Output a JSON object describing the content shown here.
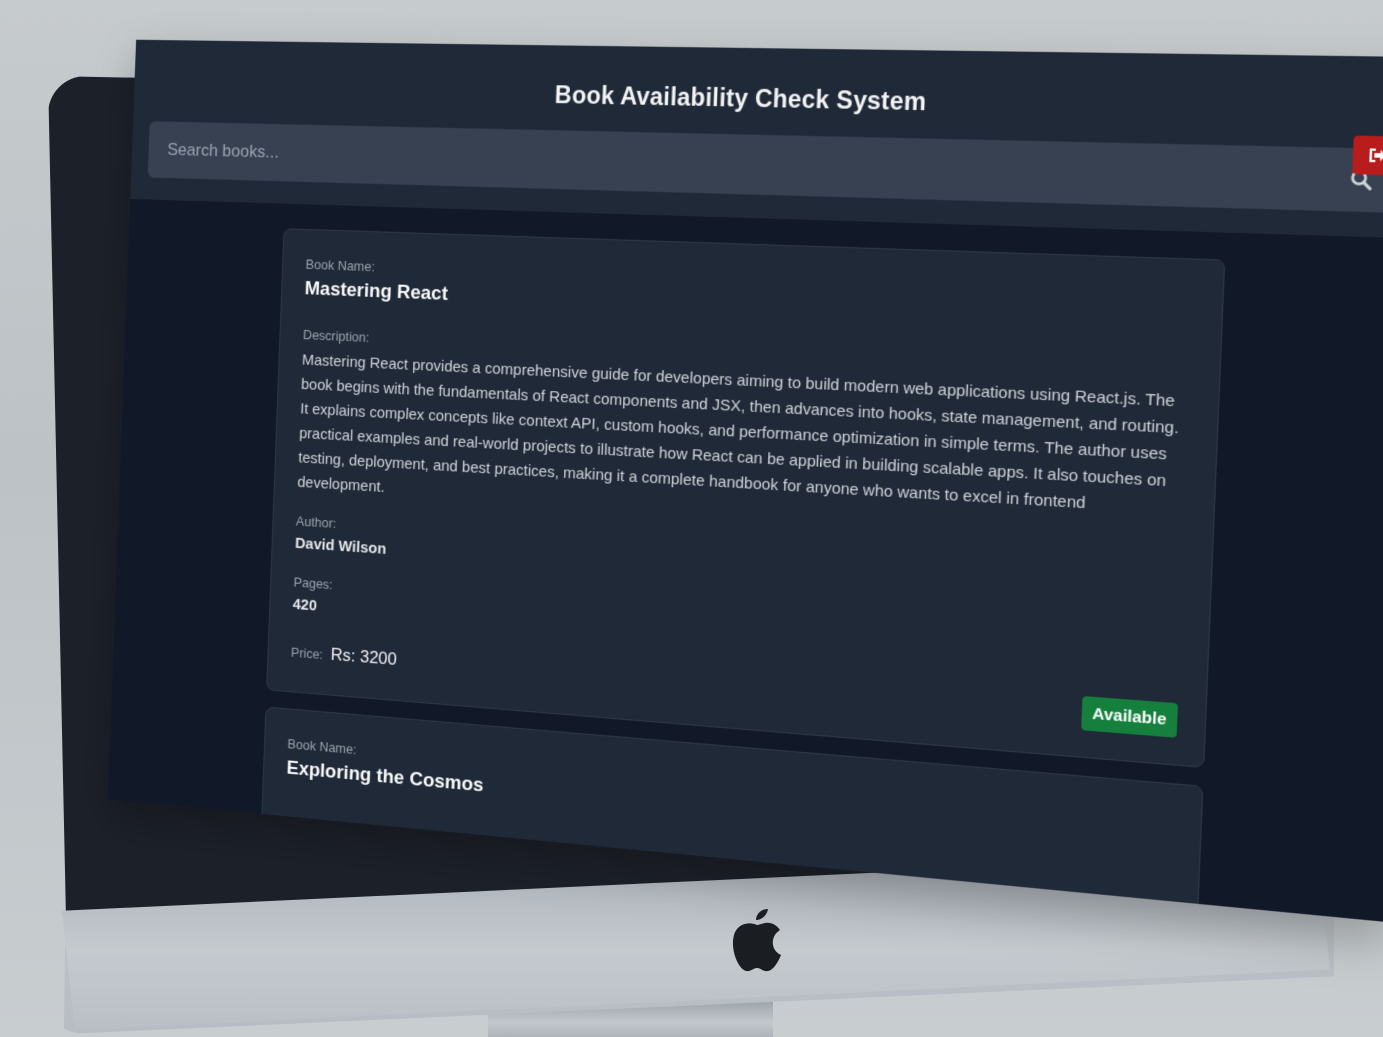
{
  "app": {
    "title": "Book Availability Check System"
  },
  "search": {
    "placeholder": "Search books..."
  },
  "icons": {
    "logout": "logout-icon",
    "search": "search-icon",
    "apple": "apple-logo-icon"
  },
  "colors": {
    "logout_button": "#b91c1c",
    "available_badge": "#15803d",
    "background": "#111827",
    "card": "#1f2937"
  },
  "labels": {
    "book_name": "Book Name:",
    "description": "Description:",
    "author": "Author:",
    "pages": "Pages:",
    "price": "Price:"
  },
  "books": [
    {
      "name": "Mastering React",
      "description": "Mastering React provides a comprehensive guide for developers aiming to build modern web applications using React.js. The book begins with the fundamentals of React components and JSX, then advances into hooks, state management, and routing. It explains complex concepts like context API, custom hooks, and performance optimization in simple terms. The author uses practical examples and real-world projects to illustrate how React can be applied in building scalable apps. It also touches on testing, deployment, and best practices, making it a complete handbook for anyone who wants to excel in frontend development.",
      "author": "David Wilson",
      "pages": "420",
      "price": "Rs: 3200",
      "status": "Available"
    },
    {
      "name": "Exploring the Cosmos"
    }
  ]
}
